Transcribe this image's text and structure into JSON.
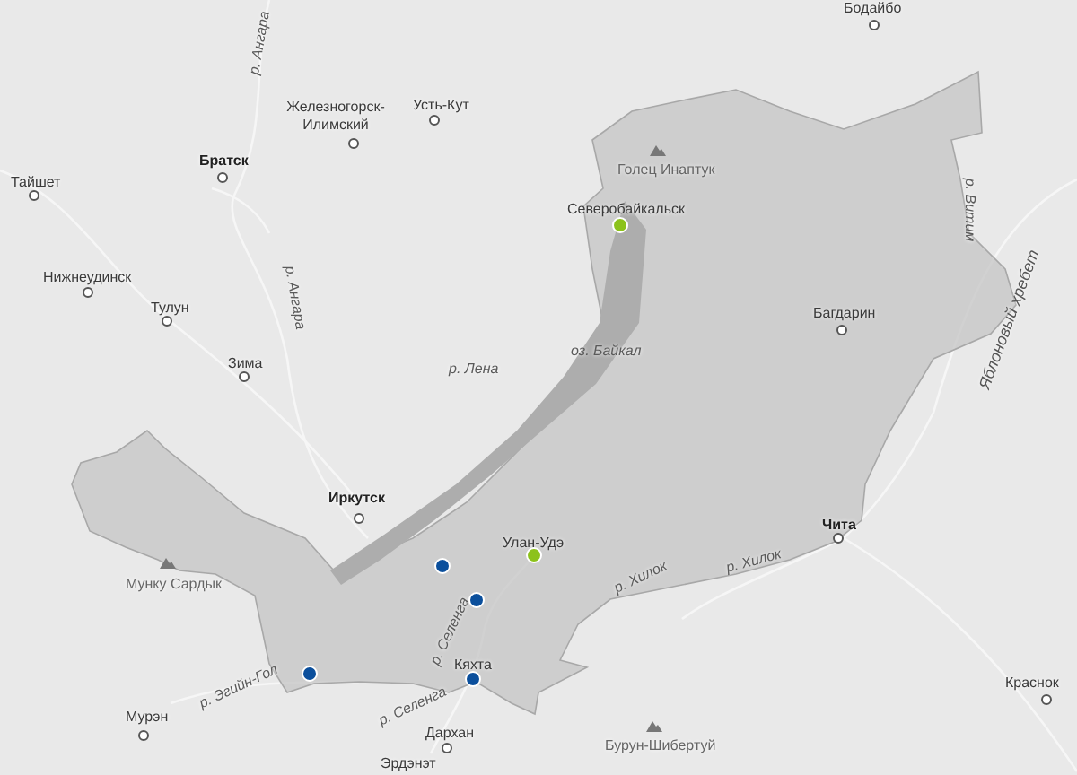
{
  "map": {
    "places": [
      {
        "name": "Бодайбо",
        "kind": "city"
      },
      {
        "name": "р. Ангара",
        "kind": "river"
      },
      {
        "name": "Железногорск-Илимский",
        "kind": "city"
      },
      {
        "name": "Усть-Кут",
        "kind": "city"
      },
      {
        "name": "Голец Инаптук",
        "kind": "peak"
      },
      {
        "name": "Братск",
        "kind": "major_city"
      },
      {
        "name": "Тайшет",
        "kind": "city"
      },
      {
        "name": "Северобайкальск",
        "kind": "town"
      },
      {
        "name": "р. Витим",
        "kind": "river"
      },
      {
        "name": "Нижнеудинск",
        "kind": "city"
      },
      {
        "name": "р. Ангара",
        "kind": "river"
      },
      {
        "name": "Тулун",
        "kind": "city"
      },
      {
        "name": "Багдарин",
        "kind": "city"
      },
      {
        "name": "Яблоновый хребет",
        "kind": "ridge"
      },
      {
        "name": "оз. Байкал",
        "kind": "lake"
      },
      {
        "name": "Зима",
        "kind": "city"
      },
      {
        "name": "р. Лена",
        "kind": "river"
      },
      {
        "name": "Иркутск",
        "kind": "major_city"
      },
      {
        "name": "Чита",
        "kind": "major_city"
      },
      {
        "name": "Улан-Удэ",
        "kind": "town"
      },
      {
        "name": "р. Хилок",
        "kind": "river"
      },
      {
        "name": "Мунку Сардык",
        "kind": "peak"
      },
      {
        "name": "р. Хилок",
        "kind": "river"
      },
      {
        "name": "р. Селенга",
        "kind": "river"
      },
      {
        "name": "Кяхта",
        "kind": "town"
      },
      {
        "name": "Краснок",
        "kind": "city"
      },
      {
        "name": "р. Эгийн-Гол",
        "kind": "river"
      },
      {
        "name": "р. Селенга",
        "kind": "river"
      },
      {
        "name": "Мурэн",
        "kind": "city"
      },
      {
        "name": "Дархан",
        "kind": "city"
      },
      {
        "name": "Бурун-Шибертуй",
        "kind": "peak"
      },
      {
        "name": "Эрдэнэт",
        "kind": "town"
      }
    ],
    "markers": [
      {
        "color": "#8cc21b"
      },
      {
        "color": "#8cc21b"
      },
      {
        "color": "#0b4f9c"
      },
      {
        "color": "#0b4f9c"
      },
      {
        "color": "#0b4f9c"
      },
      {
        "color": "#0b4f9c"
      }
    ]
  }
}
